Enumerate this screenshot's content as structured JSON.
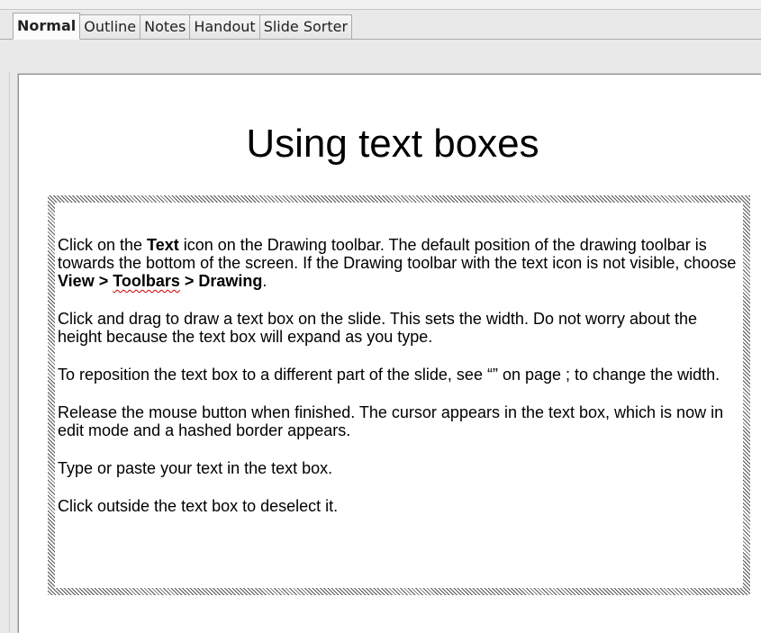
{
  "tabs": [
    {
      "label": "Normal",
      "active": true
    },
    {
      "label": "Outline",
      "active": false
    },
    {
      "label": "Notes",
      "active": false
    },
    {
      "label": "Handout",
      "active": false
    },
    {
      "label": "Slide Sorter",
      "active": false
    }
  ],
  "slide": {
    "title": "Using text boxes",
    "p1": {
      "t1": "Click on the ",
      "b1": "Text",
      "t2": " icon on the Drawing toolbar. The default position of the drawing toolbar is towards the bottom of the screen. If the Drawing toolbar with the text icon is not visible, choose ",
      "b2": "View > ",
      "b3": "Toolbars",
      "b4": " > Drawing",
      "t3": "."
    },
    "p2": "Click and drag to draw a text box on the slide. This sets the width. Do not worry about the height because the text box will expand as you type.",
    "p3": "To reposition the text box to a different part of the slide, see “” on page ; to change the width.",
    "p4": "Release the mouse button when finished. The cursor appears in the text box, which is now in edit mode and a hashed border appears.",
    "p5": "Type or paste your text in the text box.",
    "p6": "Click outside the text box to deselect it."
  },
  "colors": {
    "spellcheck_underline": "#d00000",
    "hatched_border": "#555555"
  }
}
